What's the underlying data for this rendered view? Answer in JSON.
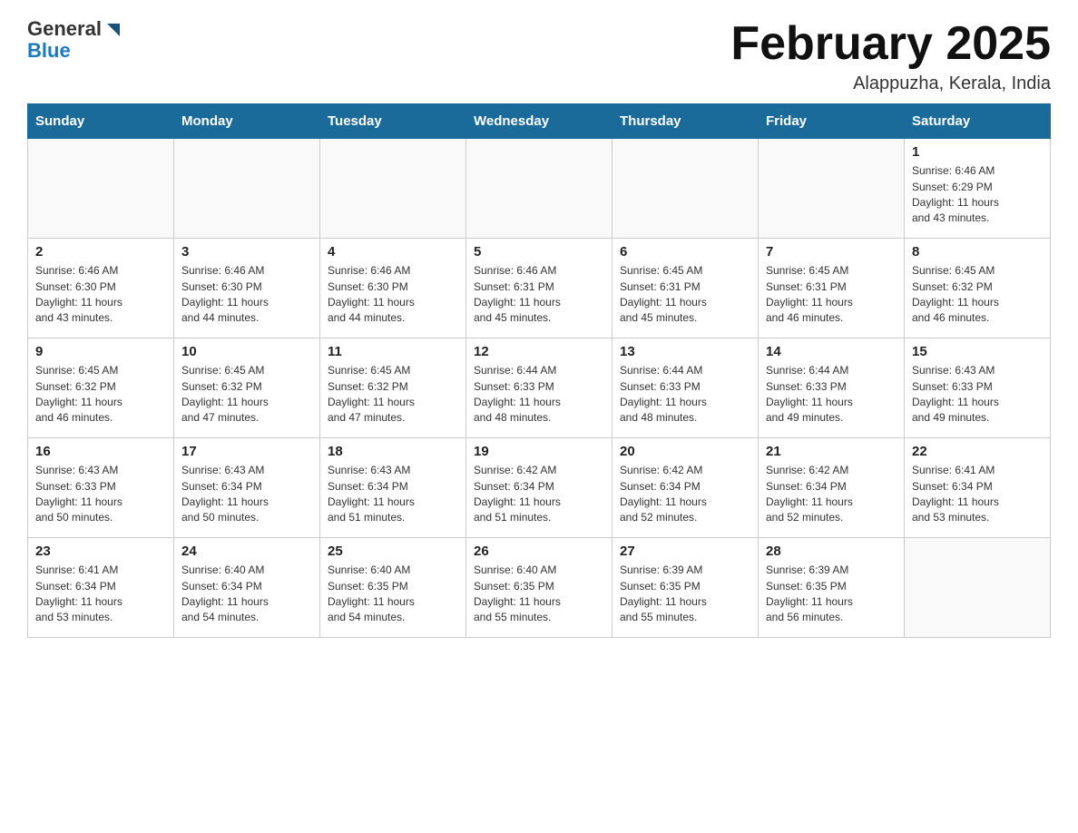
{
  "header": {
    "logo_general": "General",
    "logo_blue": "Blue",
    "month_title": "February 2025",
    "location": "Alappuzha, Kerala, India"
  },
  "days_of_week": [
    "Sunday",
    "Monday",
    "Tuesday",
    "Wednesday",
    "Thursday",
    "Friday",
    "Saturday"
  ],
  "weeks": [
    [
      {
        "day": "",
        "info": ""
      },
      {
        "day": "",
        "info": ""
      },
      {
        "day": "",
        "info": ""
      },
      {
        "day": "",
        "info": ""
      },
      {
        "day": "",
        "info": ""
      },
      {
        "day": "",
        "info": ""
      },
      {
        "day": "1",
        "info": "Sunrise: 6:46 AM\nSunset: 6:29 PM\nDaylight: 11 hours\nand 43 minutes."
      }
    ],
    [
      {
        "day": "2",
        "info": "Sunrise: 6:46 AM\nSunset: 6:30 PM\nDaylight: 11 hours\nand 43 minutes."
      },
      {
        "day": "3",
        "info": "Sunrise: 6:46 AM\nSunset: 6:30 PM\nDaylight: 11 hours\nand 44 minutes."
      },
      {
        "day": "4",
        "info": "Sunrise: 6:46 AM\nSunset: 6:30 PM\nDaylight: 11 hours\nand 44 minutes."
      },
      {
        "day": "5",
        "info": "Sunrise: 6:46 AM\nSunset: 6:31 PM\nDaylight: 11 hours\nand 45 minutes."
      },
      {
        "day": "6",
        "info": "Sunrise: 6:45 AM\nSunset: 6:31 PM\nDaylight: 11 hours\nand 45 minutes."
      },
      {
        "day": "7",
        "info": "Sunrise: 6:45 AM\nSunset: 6:31 PM\nDaylight: 11 hours\nand 46 minutes."
      },
      {
        "day": "8",
        "info": "Sunrise: 6:45 AM\nSunset: 6:32 PM\nDaylight: 11 hours\nand 46 minutes."
      }
    ],
    [
      {
        "day": "9",
        "info": "Sunrise: 6:45 AM\nSunset: 6:32 PM\nDaylight: 11 hours\nand 46 minutes."
      },
      {
        "day": "10",
        "info": "Sunrise: 6:45 AM\nSunset: 6:32 PM\nDaylight: 11 hours\nand 47 minutes."
      },
      {
        "day": "11",
        "info": "Sunrise: 6:45 AM\nSunset: 6:32 PM\nDaylight: 11 hours\nand 47 minutes."
      },
      {
        "day": "12",
        "info": "Sunrise: 6:44 AM\nSunset: 6:33 PM\nDaylight: 11 hours\nand 48 minutes."
      },
      {
        "day": "13",
        "info": "Sunrise: 6:44 AM\nSunset: 6:33 PM\nDaylight: 11 hours\nand 48 minutes."
      },
      {
        "day": "14",
        "info": "Sunrise: 6:44 AM\nSunset: 6:33 PM\nDaylight: 11 hours\nand 49 minutes."
      },
      {
        "day": "15",
        "info": "Sunrise: 6:43 AM\nSunset: 6:33 PM\nDaylight: 11 hours\nand 49 minutes."
      }
    ],
    [
      {
        "day": "16",
        "info": "Sunrise: 6:43 AM\nSunset: 6:33 PM\nDaylight: 11 hours\nand 50 minutes."
      },
      {
        "day": "17",
        "info": "Sunrise: 6:43 AM\nSunset: 6:34 PM\nDaylight: 11 hours\nand 50 minutes."
      },
      {
        "day": "18",
        "info": "Sunrise: 6:43 AM\nSunset: 6:34 PM\nDaylight: 11 hours\nand 51 minutes."
      },
      {
        "day": "19",
        "info": "Sunrise: 6:42 AM\nSunset: 6:34 PM\nDaylight: 11 hours\nand 51 minutes."
      },
      {
        "day": "20",
        "info": "Sunrise: 6:42 AM\nSunset: 6:34 PM\nDaylight: 11 hours\nand 52 minutes."
      },
      {
        "day": "21",
        "info": "Sunrise: 6:42 AM\nSunset: 6:34 PM\nDaylight: 11 hours\nand 52 minutes."
      },
      {
        "day": "22",
        "info": "Sunrise: 6:41 AM\nSunset: 6:34 PM\nDaylight: 11 hours\nand 53 minutes."
      }
    ],
    [
      {
        "day": "23",
        "info": "Sunrise: 6:41 AM\nSunset: 6:34 PM\nDaylight: 11 hours\nand 53 minutes."
      },
      {
        "day": "24",
        "info": "Sunrise: 6:40 AM\nSunset: 6:34 PM\nDaylight: 11 hours\nand 54 minutes."
      },
      {
        "day": "25",
        "info": "Sunrise: 6:40 AM\nSunset: 6:35 PM\nDaylight: 11 hours\nand 54 minutes."
      },
      {
        "day": "26",
        "info": "Sunrise: 6:40 AM\nSunset: 6:35 PM\nDaylight: 11 hours\nand 55 minutes."
      },
      {
        "day": "27",
        "info": "Sunrise: 6:39 AM\nSunset: 6:35 PM\nDaylight: 11 hours\nand 55 minutes."
      },
      {
        "day": "28",
        "info": "Sunrise: 6:39 AM\nSunset: 6:35 PM\nDaylight: 11 hours\nand 56 minutes."
      },
      {
        "day": "",
        "info": ""
      }
    ]
  ]
}
